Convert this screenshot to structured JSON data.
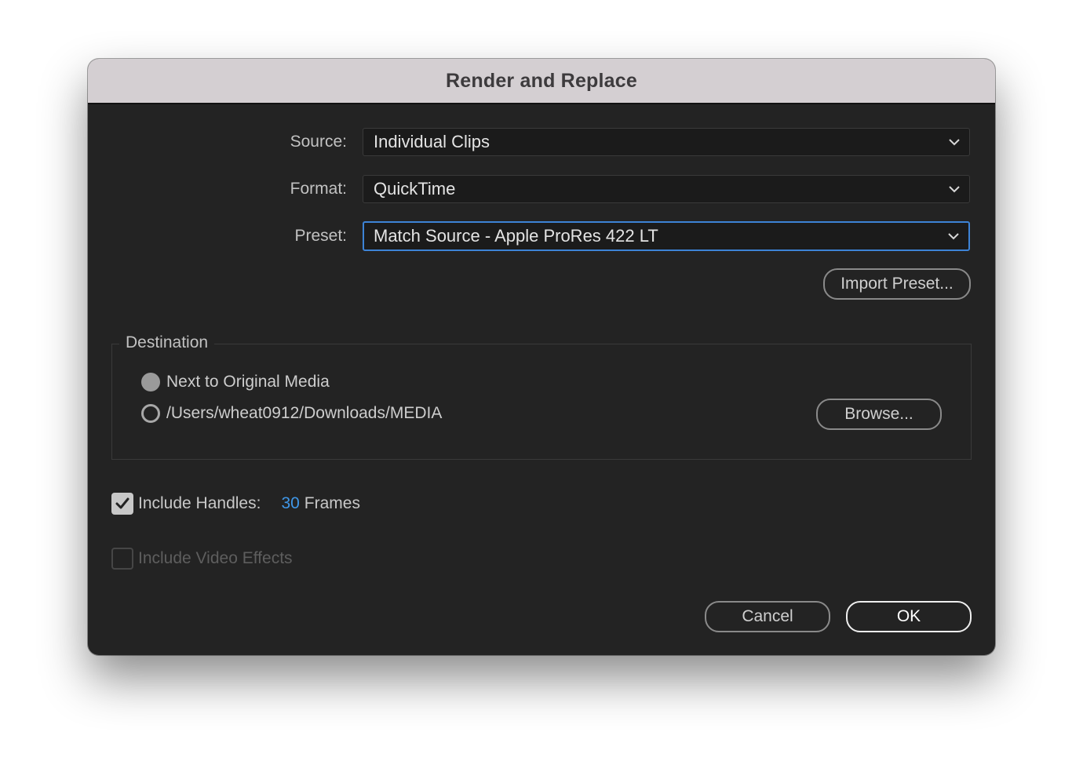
{
  "dialog": {
    "title": "Render and Replace"
  },
  "fields": {
    "source_label": "Source:",
    "source_value": "Individual Clips",
    "format_label": "Format:",
    "format_value": "QuickTime",
    "preset_label": "Preset:",
    "preset_value": "Match Source - Apple ProRes 422 LT",
    "import_preset_button": "Import Preset..."
  },
  "destination": {
    "group_label": "Destination",
    "option_next_to_original": "Next to Original Media",
    "option_custom_path": "/Users/wheat0912/Downloads/MEDIA",
    "selected": "Next to Original Media",
    "browse_button": "Browse..."
  },
  "handles": {
    "label": "Include Handles:",
    "checked": true,
    "value": "30",
    "unit": "Frames"
  },
  "video_effects": {
    "label": "Include Video Effects",
    "checked": false,
    "enabled": false
  },
  "footer": {
    "cancel_button": "Cancel",
    "ok_button": "OK"
  },
  "colors": {
    "accent": "#3d83d6",
    "value_blue": "#3f97e8",
    "dialog_bg": "#232323",
    "titlebar_bg": "#d4cfd2"
  },
  "icons": {
    "dropdown": "chevron-down-icon",
    "checkbox": "checkmark-icon"
  }
}
